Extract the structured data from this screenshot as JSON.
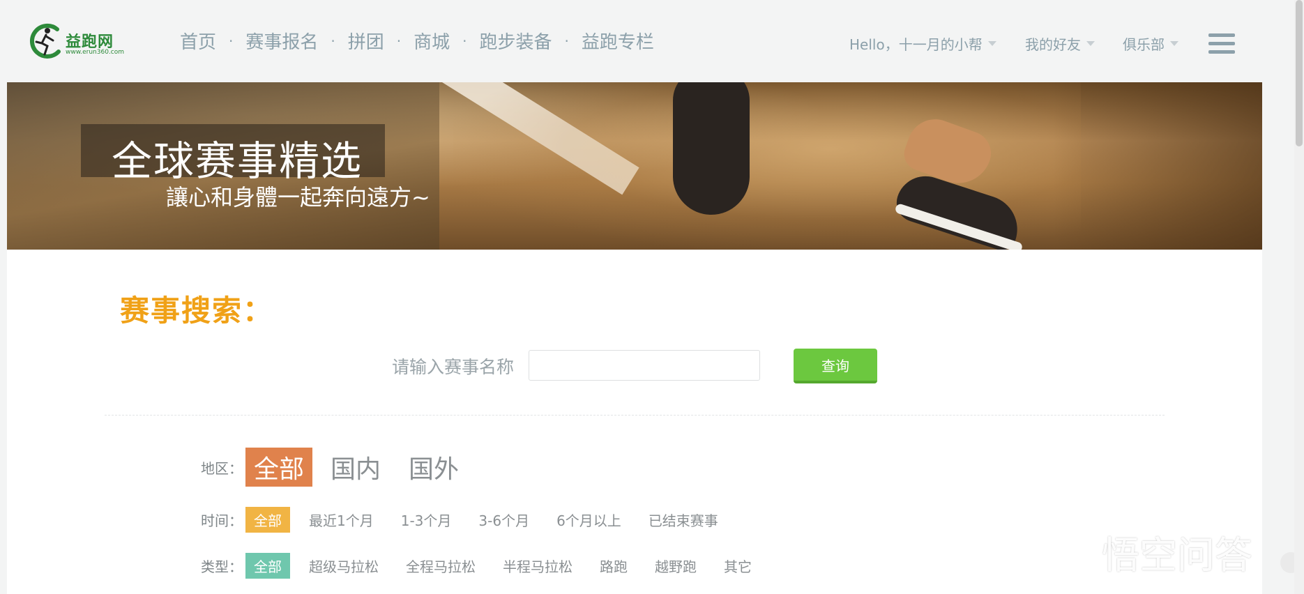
{
  "header": {
    "logo_text": "益跑网",
    "logo_url": "www.erun360.com",
    "nav": [
      "首页",
      "赛事报名",
      "拼团",
      "商城",
      "跑步装备",
      "益跑专栏"
    ],
    "nav_separator": "·",
    "user": {
      "greeting": "Hello，十一月的小帮",
      "friends": "我的好友",
      "club": "俱乐部"
    }
  },
  "banner": {
    "title": "全球赛事精选",
    "subtitle": "讓心和身體一起奔向遠方~"
  },
  "search": {
    "title": "赛事搜索：",
    "label": "请输入赛事名称",
    "input_value": "",
    "button": "查询"
  },
  "filters": {
    "region": {
      "label": "地区：",
      "options": [
        "全部",
        "国内",
        "国外"
      ],
      "selected": "全部"
    },
    "time": {
      "label": "时间：",
      "options": [
        "全部",
        "最近1个月",
        "1-3个月",
        "3-6个月",
        "6个月以上",
        "已结束赛事"
      ],
      "selected": "全部"
    },
    "type": {
      "label": "类型：",
      "options": [
        "全部",
        "超级马拉松",
        "全程马拉松",
        "半程马拉松",
        "路跑",
        "越野跑",
        "其它"
      ],
      "selected": "全部"
    }
  },
  "watermark": "悟空问答",
  "colors": {
    "accent_orange": "#f0a117",
    "region_active": "#e0824c",
    "time_active": "#f1b444",
    "type_active": "#6fc7ad",
    "search_button": "#6cc83f",
    "brand_green": "#2d8a3a"
  }
}
